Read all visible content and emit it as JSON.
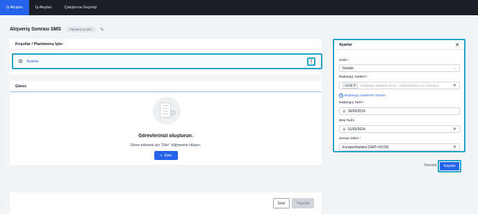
{
  "nav": {
    "tabs": [
      {
        "label": "İş Akışları",
        "active": true
      },
      {
        "label": "İş Akışları",
        "active": false
      },
      {
        "label": "Çalıştırma Geçmişi",
        "active": false
      }
    ]
  },
  "header": {
    "title": "Alışveriş Sonrası SMS",
    "status_badge": "Planlanmış İşler",
    "edit_icon": "pencil-icon"
  },
  "conditions": {
    "heading": "Koşullar / Planlanmış İşler",
    "item_label": "Ayarlar",
    "item_icon": "gears-icon",
    "more_icon": "vertical-dots-icon"
  },
  "tasks": {
    "heading": "Görev",
    "empty_title": "Görevlerinizi oluşturun.",
    "empty_subtitle": "Görev eklemek için \"Ekle\" düğmesine tıklayın.",
    "add_label": "Ekle"
  },
  "footer": {
    "cancel_label": "İptal",
    "publish_label": "Yayınla"
  },
  "settings": {
    "title": "Ayarlar",
    "frequency_label": "Sıklık",
    "frequency_value": "Günlük",
    "start_times_label": "Başlangıç Saatleri",
    "start_time_chip": "13:00",
    "start_times_placeholder": "Başlangıç saatlerini seçin... Daha fazlasını için yazmaya",
    "add_start_times": "Başlangıç Saatlerini Oluştur",
    "start_date_label": "Başlangıç Tarihi",
    "start_date_value": "30/05/2024",
    "end_date_label": "Bitiş Tarihi",
    "end_date_value": "31/05/2024",
    "timezone_label": "Zaman Dilimi",
    "timezone_value": "Europe/Istanbul (GMT+03:00)",
    "required_mark": "*",
    "clear_label": "Temizle",
    "save_label": "Kaydet"
  },
  "colors": {
    "accent": "#2563eb",
    "highlight": "#1fa3c9",
    "topbar": "#1c1d26",
    "required": "#dc2626"
  }
}
